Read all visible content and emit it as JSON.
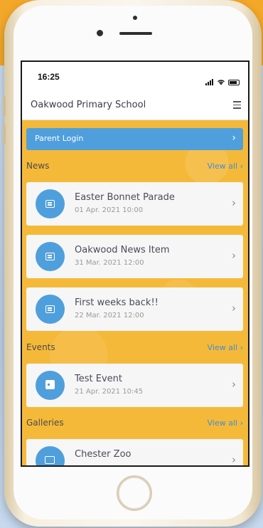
{
  "status_bar": {
    "time": "16:25"
  },
  "app": {
    "title": "Oakwood Primary School"
  },
  "parent_login": {
    "label": "Parent Login"
  },
  "sections": {
    "news": {
      "title": "News",
      "view_all": "View all",
      "items": [
        {
          "title": "Easter Bonnet Parade",
          "date": "01 Apr. 2021 10:00"
        },
        {
          "title": "Oakwood News Item",
          "date": "31 Mar. 2021 12:00"
        },
        {
          "title": "First weeks back!!",
          "date": "22 Mar. 2021 12:00"
        }
      ]
    },
    "events": {
      "title": "Events",
      "view_all": "View all",
      "items": [
        {
          "title": "Test Event",
          "date": "21 Apr. 2021 10:45"
        }
      ]
    },
    "galleries": {
      "title": "Galleries",
      "view_all": "View all",
      "items": [
        {
          "title": "Chester Zoo"
        }
      ]
    }
  },
  "icons": {
    "news_item": "newspaper-icon",
    "event_item": "calendar-icon",
    "gallery_item": "image-gallery-icon",
    "menu": "hamburger-menu-icon",
    "chevron": "chevron-right-icon"
  },
  "colors": {
    "accent_blue": "#4f9fdc",
    "background_yellow": "#f5b93a",
    "card": "#f6f6f6"
  }
}
